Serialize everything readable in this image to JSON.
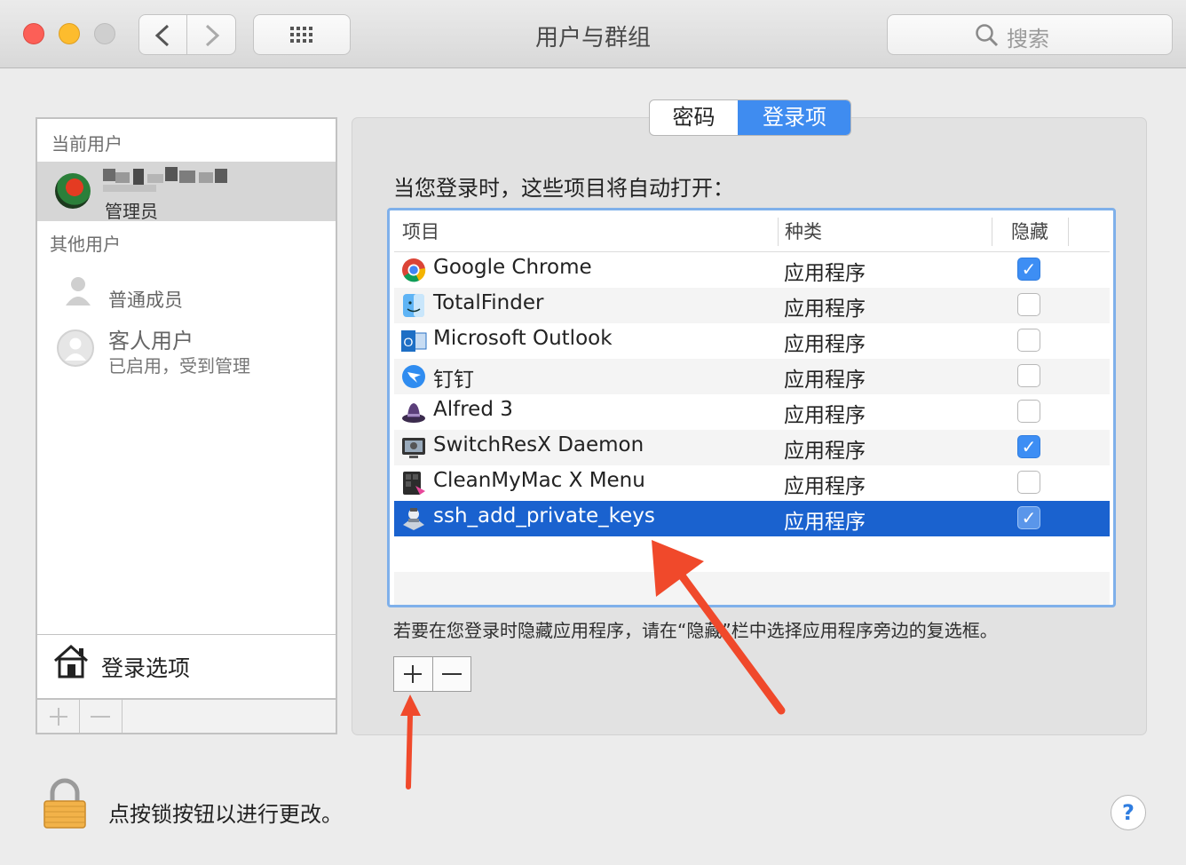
{
  "window": {
    "title": "用户与群组",
    "search_placeholder": "搜索"
  },
  "sidebar": {
    "current_user_header": "当前用户",
    "current_user": {
      "name": "",
      "role": "管理员"
    },
    "other_users_header": "其他用户",
    "other_users": [
      {
        "name": "普通成员",
        "subtitle": ""
      },
      {
        "name": "客人用户",
        "subtitle": "已启用，受到管理"
      }
    ],
    "login_options_label": "登录选项"
  },
  "tabs": [
    {
      "label": "密码",
      "selected": false
    },
    {
      "label": "登录项",
      "selected": true
    }
  ],
  "login_items": {
    "intro": "当您登录时，这些项目将自动打开：",
    "columns": {
      "item": "项目",
      "kind": "种类",
      "hide": "隐藏"
    },
    "rows": [
      {
        "name": "Google Chrome",
        "kind": "应用程序",
        "hidden": true,
        "selected": false,
        "icon": "chrome-icon"
      },
      {
        "name": "TotalFinder",
        "kind": "应用程序",
        "hidden": false,
        "selected": false,
        "icon": "totalfinder-icon"
      },
      {
        "name": "Microsoft Outlook",
        "kind": "应用程序",
        "hidden": false,
        "selected": false,
        "icon": "outlook-icon"
      },
      {
        "name": "钉钉",
        "kind": "应用程序",
        "hidden": false,
        "selected": false,
        "icon": "dingtalk-icon"
      },
      {
        "name": "Alfred 3",
        "kind": "应用程序",
        "hidden": false,
        "selected": false,
        "icon": "alfred-icon"
      },
      {
        "name": "SwitchResX Daemon",
        "kind": "应用程序",
        "hidden": true,
        "selected": false,
        "icon": "switchresx-icon"
      },
      {
        "name": "CleanMyMac X Menu",
        "kind": "应用程序",
        "hidden": false,
        "selected": false,
        "icon": "cleanmymac-icon"
      },
      {
        "name": "ssh_add_private_keys",
        "kind": "应用程序",
        "hidden": true,
        "selected": true,
        "icon": "automator-icon"
      }
    ],
    "hint": "若要在您登录时隐藏应用程序，请在“隐藏”栏中选择应用程序旁边的复选框。"
  },
  "lock": {
    "text": "点按锁按钮以进行更改。"
  },
  "help": {
    "label": "?"
  },
  "colors": {
    "selection": "#1a62cf",
    "accent": "#3d8ef4",
    "annotation_arrow": "#f0492b"
  }
}
